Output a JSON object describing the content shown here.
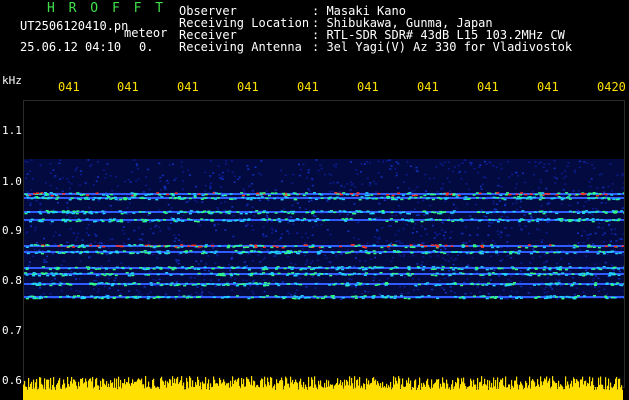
{
  "header": {
    "brand": "H R O F F T",
    "filename": "UT2506120410.pn",
    "mode": "meteor",
    "datetime": "25.06.12 04:10",
    "value": "0.",
    "info": [
      {
        "label": "Observer",
        "value": ": Masaki Kano"
      },
      {
        "label": "Receiving Location",
        "value": ": Shibukawa, Gunma, Japan"
      },
      {
        "label": "Receiver",
        "value": ": RTL-SDR SDR# 43dB L15 103.2MHz CW"
      },
      {
        "label": "Receiving Antenna",
        "value": ": 3el Yagi(V) Az 330 for Vladivostok"
      }
    ]
  },
  "time_axis": {
    "labels": [
      "041",
      "041",
      "041",
      "041",
      "041",
      "041",
      "041",
      "041",
      "041",
      "0420"
    ]
  },
  "freq_axis": {
    "unit": "kHz",
    "labels": [
      "1.1",
      "1.0",
      "0.9",
      "0.8",
      "0.7",
      "0.6"
    ]
  },
  "colors": {
    "background": "#000000",
    "brand": "#3fe04a",
    "text": "#ffffff",
    "time_labels": "#ffe000",
    "noise_floor": "#0a1a8a",
    "band_hot": "#ff3020",
    "audio_level": "#ffe000"
  }
}
